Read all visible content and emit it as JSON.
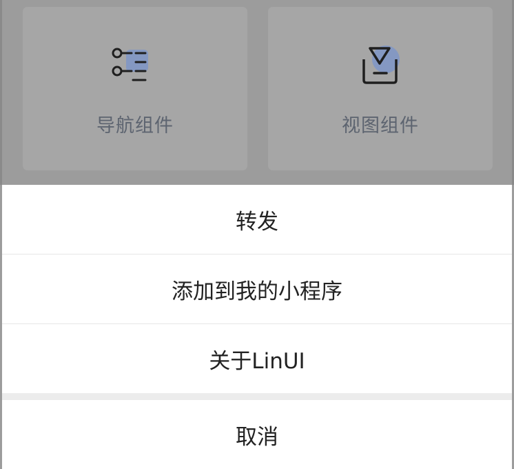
{
  "background_grid": {
    "cards": [
      {
        "label": "导航组件",
        "icon": "navigation-list-icon"
      },
      {
        "label": "视图组件",
        "icon": "view-inbox-icon"
      }
    ]
  },
  "action_sheet": {
    "items": [
      {
        "label": "转发"
      },
      {
        "label": "添加到我的小程序"
      },
      {
        "label": "关于LinUI"
      }
    ],
    "cancel_label": "取消"
  },
  "colors": {
    "overlay": "#9c9c9c",
    "card": "#a6a6a6",
    "icon_accent": "#7e95c7",
    "sheet_bg": "#ffffff"
  }
}
